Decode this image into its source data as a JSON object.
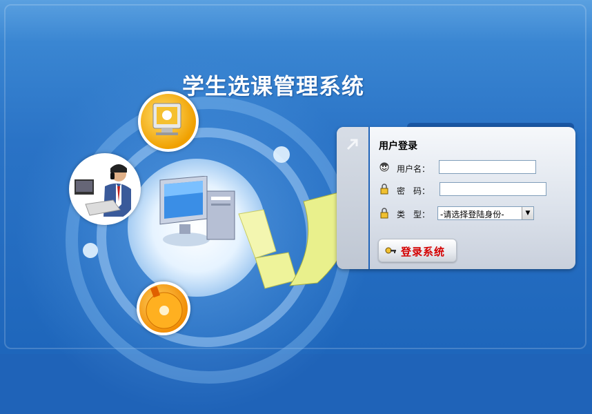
{
  "app": {
    "title": "学生选课管理系统"
  },
  "login": {
    "panel_title": "用户登录",
    "username_label": "用户名：",
    "username_value": "",
    "password_label": "密　码：",
    "password_value": "",
    "type_label": "类　型：",
    "type_selected": "-请选择登陆身份-",
    "submit_label": "登录系统"
  },
  "colors": {
    "background": "#1f63b8",
    "button_text": "#d40000"
  },
  "icons": {
    "panel_corner": "arrow-up-right-icon",
    "username": "user-face-icon",
    "password": "lock-icon",
    "type": "lock-icon",
    "submit": "key-icon"
  }
}
